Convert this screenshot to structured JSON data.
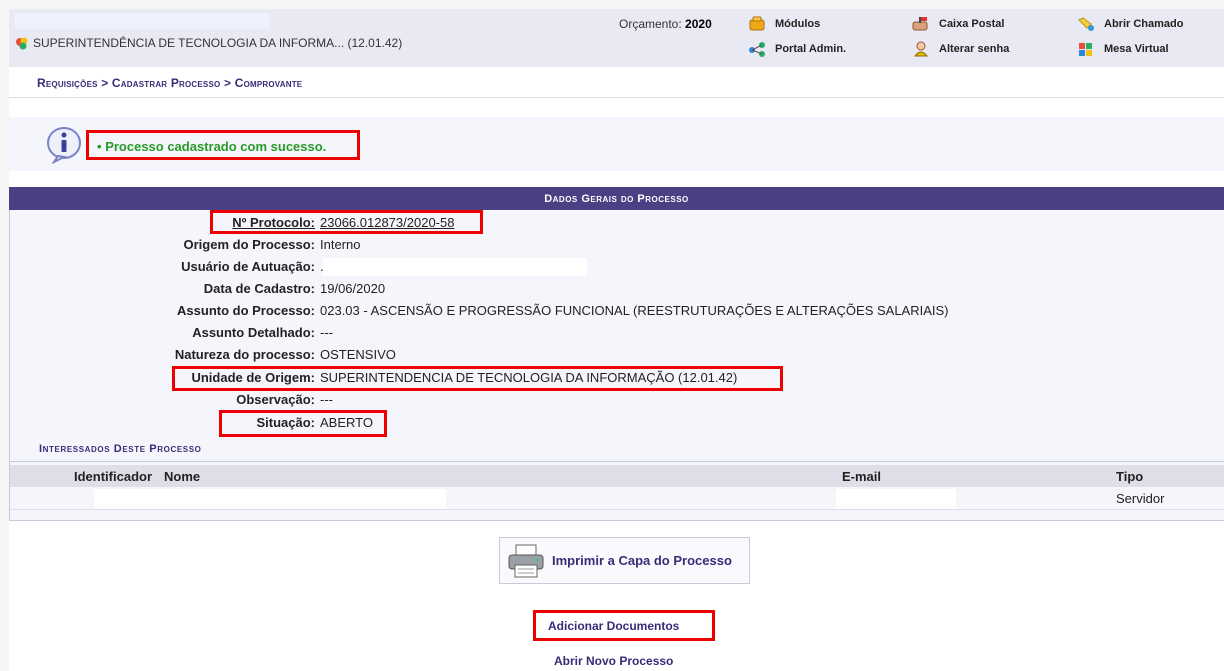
{
  "header": {
    "unit_label": "SUPERINTENDÊNCIA DE TECNOLOGIA DA INFORMA... (12.01.42)",
    "budget_label": "Orçamento:",
    "budget_year": "2020",
    "links": {
      "modulos": "Módulos",
      "caixa_postal": "Caixa Postal",
      "abrir_chamado": "Abrir Chamado",
      "portal_admin": "Portal Admin.",
      "alterar_senha": "Alterar senha",
      "mesa_virtual": "Mesa Virtual"
    }
  },
  "breadcrumb": "Requisições > Cadastrar Processo > Comprovante",
  "message": {
    "bullet": "•",
    "text": "Processo cadastrado com sucesso."
  },
  "panel": {
    "title": "Dados Gerais do Processo",
    "fields": [
      {
        "label": "Nº Protocolo:",
        "value": "23066.012873/2020-58"
      },
      {
        "label": "Origem do Processo:",
        "value": "Interno"
      },
      {
        "label": "Usuário de Autuação:",
        "value": "."
      },
      {
        "label": "Data de Cadastro:",
        "value": "19/06/2020"
      },
      {
        "label": "Assunto do Processo:",
        "value": "023.03 - ASCENSÃO E PROGRESSÃO FUNCIONAL (REESTRUTURAÇÕES E ALTERAÇÕES SALARIAIS)"
      },
      {
        "label": "Assunto Detalhado:",
        "value": "---"
      },
      {
        "label": "Natureza do processo:",
        "value": "OSTENSIVO"
      },
      {
        "label": "Unidade de Origem:",
        "value": "SUPERINTENDENCIA DE TECNOLOGIA DA INFORMAÇÃO (12.01.42)"
      },
      {
        "label": "Observação:",
        "value": "---"
      },
      {
        "label": "Situação:",
        "value": "ABERTO"
      }
    ]
  },
  "interessados": {
    "title": "Interessados Deste Processo",
    "columns": {
      "identificador": "Identificador",
      "nome": "Nome",
      "email": "E-mail",
      "tipo": "Tipo"
    },
    "rows": [
      {
        "identificador": "",
        "nome": "",
        "email": "",
        "tipo": "Servidor"
      }
    ]
  },
  "actions": {
    "print_cover": "Imprimir a Capa do Processo",
    "add_documents": "Adicionar Documentos",
    "new_process": "Abrir Novo Processo"
  },
  "colors": {
    "header_bar": "#e9e9f3",
    "panel_head": "#4a4084",
    "link_purple": "#3b2a78",
    "success_green": "#2a9a2a",
    "highlight_red": "#ee0000"
  }
}
